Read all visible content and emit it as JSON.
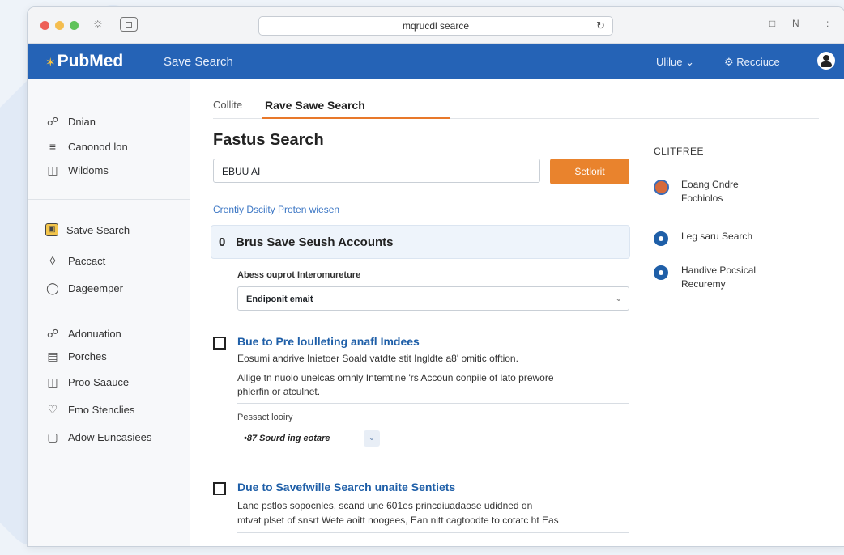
{
  "browser": {
    "url": "mqrucdl searce",
    "right_icons": [
      "□",
      "N",
      ":"
    ]
  },
  "header": {
    "logo": "PubMed",
    "title": "Save Search",
    "menu_label": "Ulilue",
    "resource_label": "Recciuce"
  },
  "nav": {
    "group1": [
      {
        "label": "Dnian",
        "icon": "link-icon"
      },
      {
        "label": "Canonod lon",
        "icon": "list-icon"
      },
      {
        "label": "Wildoms",
        "icon": "window-icon"
      }
    ],
    "group2": [
      {
        "label": "Satve Search",
        "icon": "save-icon",
        "active": true
      },
      {
        "label": "Paccact",
        "icon": "tag-icon"
      },
      {
        "label": "Dageemper",
        "icon": "circle-icon"
      }
    ],
    "group3": [
      {
        "label": "Adonuation",
        "icon": "link-icon"
      },
      {
        "label": "Porches",
        "icon": "card-icon"
      },
      {
        "label": "Proo Saauce",
        "icon": "bookmark-icon"
      },
      {
        "label": "Fmo Stenclies",
        "icon": "heart-icon"
      },
      {
        "label": "Adow Euncasiees",
        "icon": "document-icon"
      }
    ]
  },
  "tabs": [
    {
      "label": "Collite"
    },
    {
      "label": "Rave Sawe Search",
      "active": true
    }
  ],
  "main": {
    "title": "Fastus Search",
    "search_value": "EBUU AI",
    "search_button": "Setlorit",
    "search_link": "Crentiy Dsciity Proten wiesen",
    "section_count": "0",
    "section_title": "Brus Save Seush Accounts",
    "field_label": "Abess ouprot Interomureture",
    "select_value": "Endiponit emait"
  },
  "results": [
    {
      "title": "Bue to Pre loulleting anafl Imdees",
      "line1": "Eosumi andrive Inietoer Soald vatdte stit Ingldte a8' omitic offtion.",
      "line2": "Allige tn nuolo unelcas omnly Intemtine 'rs Accoun conpile of lato prewore",
      "line3": "phlerfin or atculnet.",
      "sub_label": "Pessact looiry",
      "chip": "•87 Sourd ing eotare"
    },
    {
      "title": "Due to Savefwille Search unaite Sentiets",
      "line1": "Lane pstlos sopocnles, scand une 601es princdiuadaose udidned on",
      "line2": "mtvat plset of snsrt Wete aoitt noogees, Ean nitt cagtoodte to cotatc ht Eas"
    }
  ],
  "right_panel": {
    "title": "CLITFREE",
    "items": [
      {
        "line1": "Eoang Cndre",
        "line2": "Fochiolos",
        "icon": "avatar-photo-icon"
      },
      {
        "line1": "Leg saru Search",
        "line2": "",
        "icon": "info-circle-icon"
      },
      {
        "line1": "Handive Pocsical",
        "line2": "Recuremy",
        "icon": "info-circle-icon"
      }
    ]
  }
}
